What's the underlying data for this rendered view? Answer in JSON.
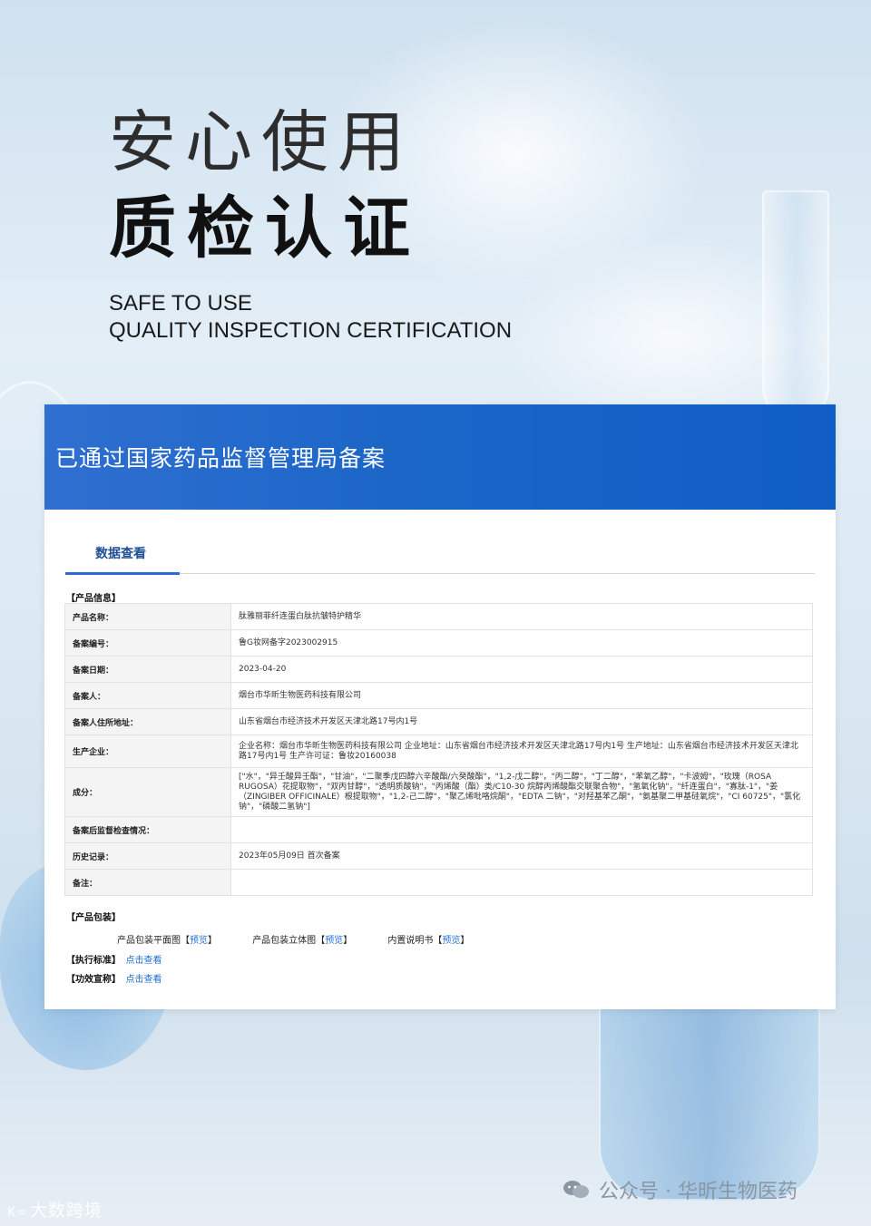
{
  "hero": {
    "line1": "安心使用",
    "line2": "质检认证",
    "en_line1": "SAFE TO USE",
    "en_line2": "QUALITY INSPECTION CERTIFICATION"
  },
  "card": {
    "header_title": "已通过国家药品监督管理局备案",
    "tab_label": "数据查看",
    "product_info_label": "【产品信息】",
    "rows": [
      {
        "key": "产品名称：",
        "value": "肽雅丽菲纤连蛋白肽抗皱特护精华"
      },
      {
        "key": "备案编号：",
        "value": "鲁G妆网备字2023002915"
      },
      {
        "key": "备案日期：",
        "value": "2023-04-20"
      },
      {
        "key": "备案人：",
        "value": "烟台市华昕生物医药科技有限公司"
      },
      {
        "key": "备案人住所地址：",
        "value": "山东省烟台市经济技术开发区天津北路17号内1号"
      },
      {
        "key": "生产企业：",
        "value": "企业名称：烟台市华昕生物医药科技有限公司 企业地址：山东省烟台市经济技术开发区天津北路17号内1号 生产地址：山东省烟台市经济技术开发区天津北路17号内1号 生产许可证：鲁妆20160038"
      },
      {
        "key": "成分：",
        "value": "[\"水\"，\"异壬酸异壬酯\"，\"甘油\"，\"二聚季戊四醇六辛酸酯/六癸酸酯\"，\"1,2-戊二醇\"，\"丙二醇\"，\"丁二醇\"，\"苯氧乙醇\"，\"卡波姆\"，\"玫瑰（ROSA RUGOSA）花提取物\"，\"双丙甘醇\"，\"透明质酸钠\"，\"丙烯酸（酯）类/C10-30 烷醇丙烯酸酯交联聚合物\"，\"氢氧化钠\"，\"纤连蛋白\"，\"寡肽-1\"，\"姜（ZINGIBER OFFICINALE）根提取物\"，\"1,2-己二醇\"，\"聚乙烯吡咯烷酮\"，\"EDTA 二钠\"，\"对羟基苯乙酮\"，\"氨基聚二甲基硅氧烷\"，\"CI 60725\"，\"氯化钠\"，\"磷酸二氢钠\"]"
      },
      {
        "key": "备案后监督检查情况：",
        "value": ""
      },
      {
        "key": "历史记录：",
        "value": "2023年05月09日 首次备案"
      },
      {
        "key": "备注：",
        "value": ""
      }
    ],
    "packaging_label": "【产品包装】",
    "packaging_items": [
      {
        "name": "产品包装平面图",
        "link": "预览"
      },
      {
        "name": "产品包装立体图",
        "link": "预览"
      },
      {
        "name": "内置说明书",
        "link": "预览"
      }
    ],
    "standard_label": "【执行标准】",
    "standard_link": "点击查看",
    "efficacy_label": "【功效宣称】",
    "efficacy_link": "点击查看"
  },
  "watermarks": {
    "left": "大数跨境",
    "right": "公众号 · 华昕生物医药"
  }
}
